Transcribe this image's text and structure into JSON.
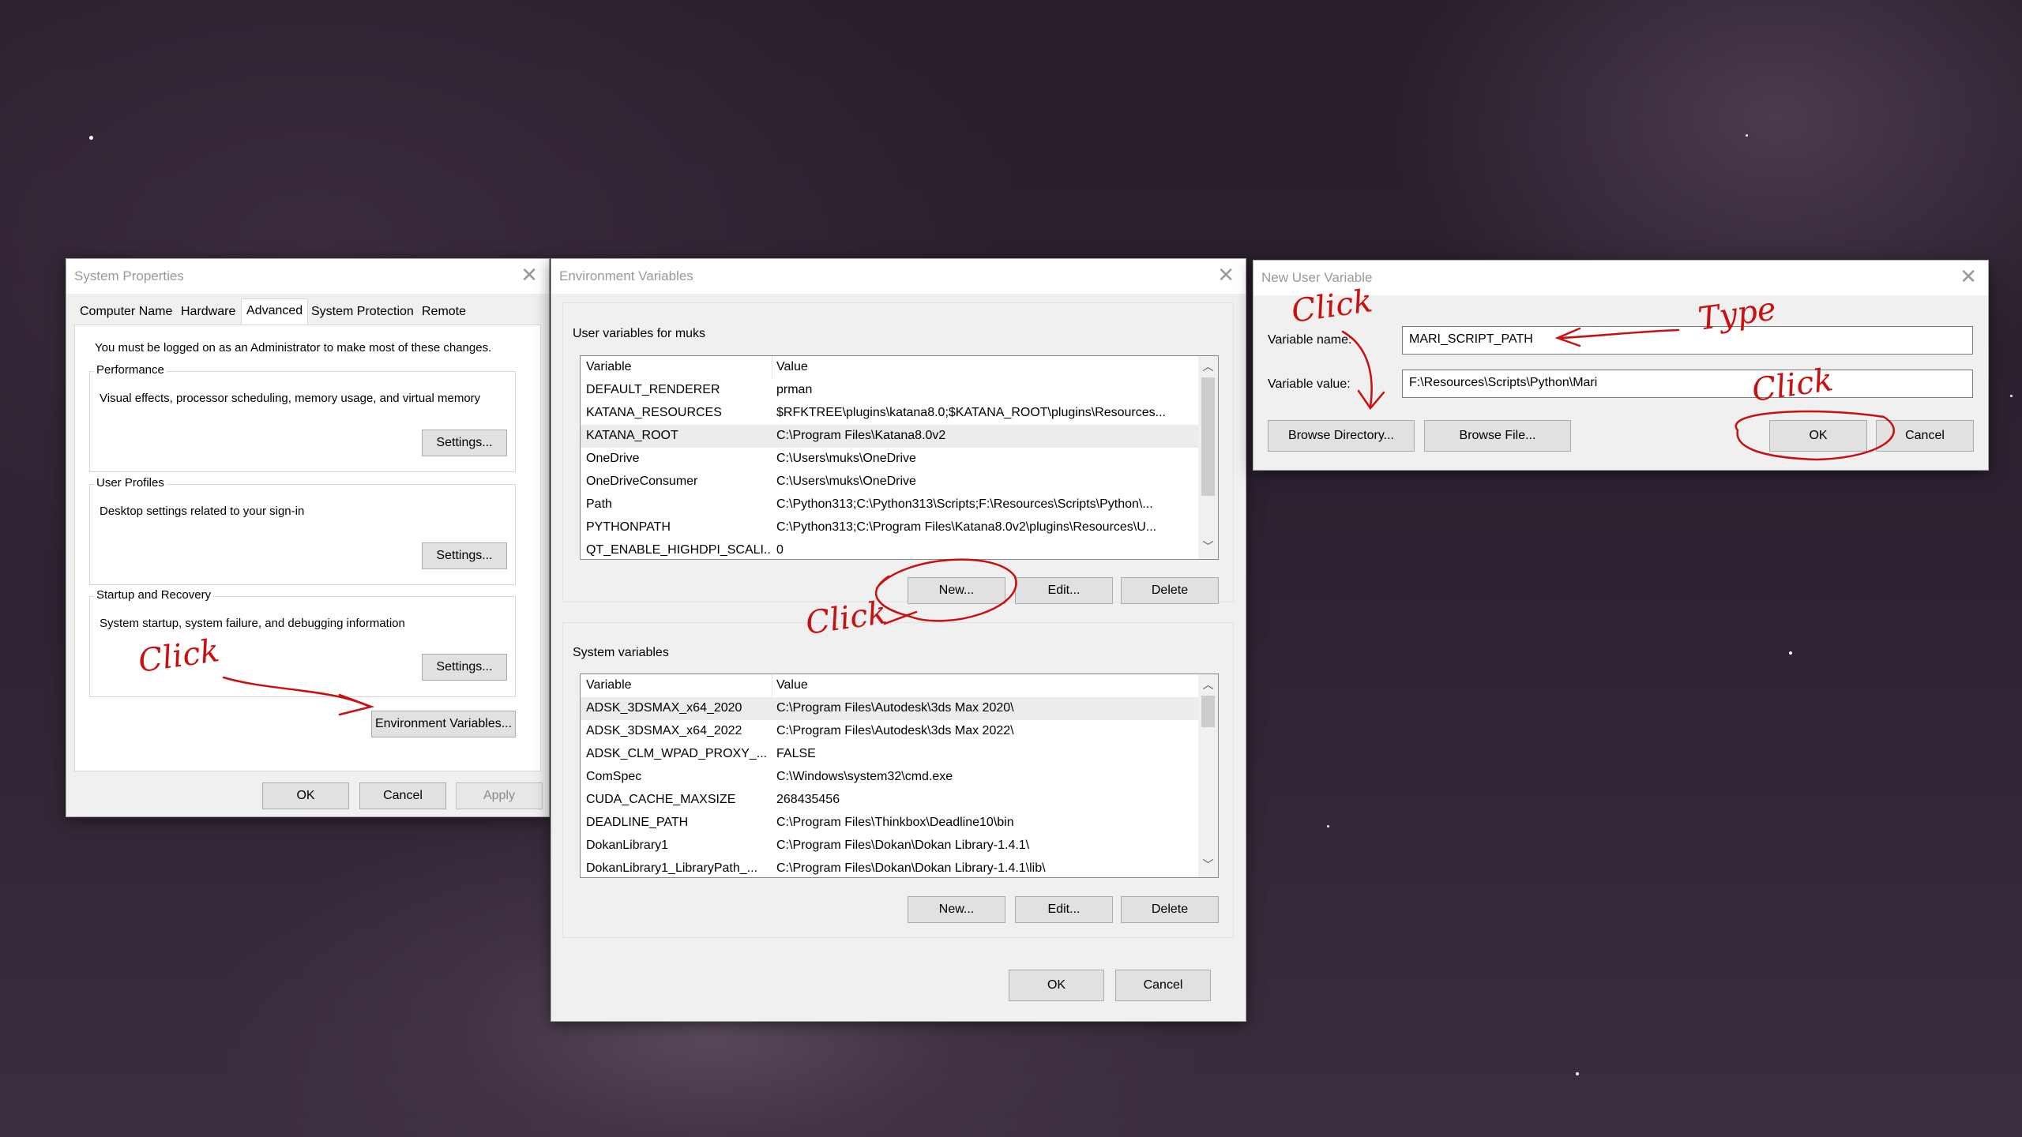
{
  "system_properties": {
    "title": "System Properties",
    "tabs": [
      "Computer Name",
      "Hardware",
      "Advanced",
      "System Protection",
      "Remote"
    ],
    "admin_note": "You must be logged on as an Administrator to make most of these changes.",
    "performance": {
      "title": "Performance",
      "desc": "Visual effects, processor scheduling, memory usage, and virtual memory",
      "button": "Settings..."
    },
    "user_profiles": {
      "title": "User Profiles",
      "desc": "Desktop settings related to your sign-in",
      "button": "Settings..."
    },
    "startup": {
      "title": "Startup and Recovery",
      "desc": "System startup, system failure, and debugging information",
      "button": "Settings..."
    },
    "env_button": "Environment Variables...",
    "ok": "OK",
    "cancel": "Cancel",
    "apply": "Apply"
  },
  "env_vars": {
    "title": "Environment Variables",
    "user_section": "User variables for muks",
    "col_variable": "Variable",
    "col_value": "Value",
    "user_rows": [
      [
        "DEFAULT_RENDERER",
        "prman"
      ],
      [
        "KATANA_RESOURCES",
        "$RFKTREE\\plugins\\katana8.0;$KATANA_ROOT\\plugins\\Resources..."
      ],
      [
        "KATANA_ROOT",
        "C:\\Program Files\\Katana8.0v2"
      ],
      [
        "OneDrive",
        "C:\\Users\\muks\\OneDrive"
      ],
      [
        "OneDriveConsumer",
        "C:\\Users\\muks\\OneDrive"
      ],
      [
        "Path",
        "C:\\Python313;C:\\Python313\\Scripts;F:\\Resources\\Scripts\\Python\\..."
      ],
      [
        "PYTHONPATH",
        "C:\\Python313;C:\\Program Files\\Katana8.0v2\\plugins\\Resources\\U..."
      ],
      [
        "QT_ENABLE_HIGHDPI_SCALI...",
        "0"
      ]
    ],
    "system_section": "System variables",
    "system_rows": [
      [
        "ADSK_3DSMAX_x64_2020",
        "C:\\Program Files\\Autodesk\\3ds Max 2020\\"
      ],
      [
        "ADSK_3DSMAX_x64_2022",
        "C:\\Program Files\\Autodesk\\3ds Max 2022\\"
      ],
      [
        "ADSK_CLM_WPAD_PROXY_...",
        "FALSE"
      ],
      [
        "ComSpec",
        "C:\\Windows\\system32\\cmd.exe"
      ],
      [
        "CUDA_CACHE_MAXSIZE",
        "268435456"
      ],
      [
        "DEADLINE_PATH",
        "C:\\Program Files\\Thinkbox\\Deadline10\\bin"
      ],
      [
        "DokanLibrary1",
        "C:\\Program Files\\Dokan\\Dokan Library-1.4.1\\"
      ],
      [
        "DokanLibrary1_LibraryPath_...",
        "C:\\Program Files\\Dokan\\Dokan Library-1.4.1\\lib\\"
      ]
    ],
    "new": "New...",
    "edit": "Edit...",
    "delete": "Delete",
    "ok": "OK",
    "cancel": "Cancel"
  },
  "new_user_var": {
    "title": "New User Variable",
    "name_label": "Variable name:",
    "name_value": "MARI_SCRIPT_PATH",
    "value_label": "Variable value:",
    "value_value": "F:\\Resources\\Scripts\\Python\\Mari",
    "browse_dir": "Browse Directory...",
    "browse_file": "Browse File...",
    "ok": "OK",
    "cancel": "Cancel"
  },
  "annotations": {
    "click": "Click",
    "type": "Type",
    "color": "#c81010"
  }
}
